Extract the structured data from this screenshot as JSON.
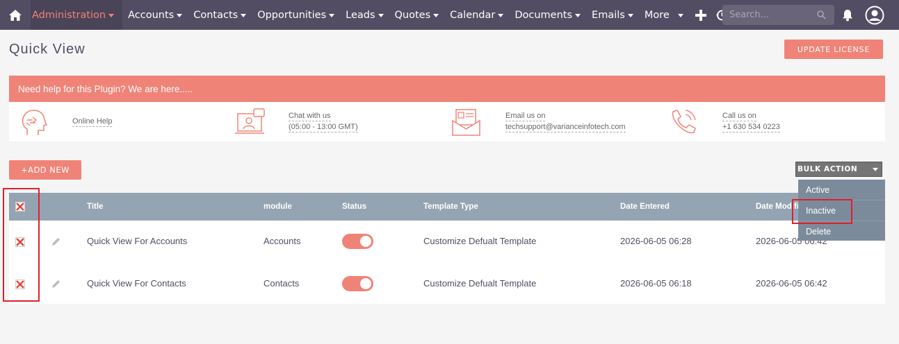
{
  "nav": {
    "active": "Administration",
    "items": [
      "Accounts",
      "Contacts",
      "Opportunities",
      "Leads",
      "Quotes",
      "Calendar",
      "Documents",
      "Emails",
      "More"
    ],
    "search_placeholder": "Search..."
  },
  "page": {
    "title": "Quick View",
    "update_license": "UPDATE LICENSE"
  },
  "help": {
    "banner": "Need help for this Plugin? We are here.....",
    "online_help": "Online Help",
    "chat_label": "Chat with us",
    "chat_hours": "(05:00 - 13:00 GMT)",
    "email_label": "Email us on",
    "email": "techsupport@varianceinfotech.com",
    "call_label": "Call us on",
    "phone": "+1 630 534 0223"
  },
  "actions": {
    "add_new": "+ADD NEW",
    "bulk_action": "BULK ACTION",
    "bulk_menu": [
      "Active",
      "Inactive",
      "Delete"
    ]
  },
  "table": {
    "headers": {
      "title": "Title",
      "module": "module",
      "status": "Status",
      "template_type": "Template Type",
      "date_entered": "Date Entered",
      "date_modified": "Date Modified"
    },
    "rows": [
      {
        "title": "Quick View For Accounts",
        "module": "Accounts",
        "template_type": "Customize Defualt Template",
        "date_entered": "2026-06-05 06:28",
        "date_modified": "2026-06-05 06:42"
      },
      {
        "title": "Quick View For Contacts",
        "module": "Contacts",
        "template_type": "Customize Defualt Template",
        "date_entered": "2026-06-05 06:18",
        "date_modified": "2026-06-05 06:42"
      }
    ]
  },
  "colors": {
    "brand": "#f08377",
    "nav_bg": "#534d64",
    "table_header": "#94a4b3"
  }
}
